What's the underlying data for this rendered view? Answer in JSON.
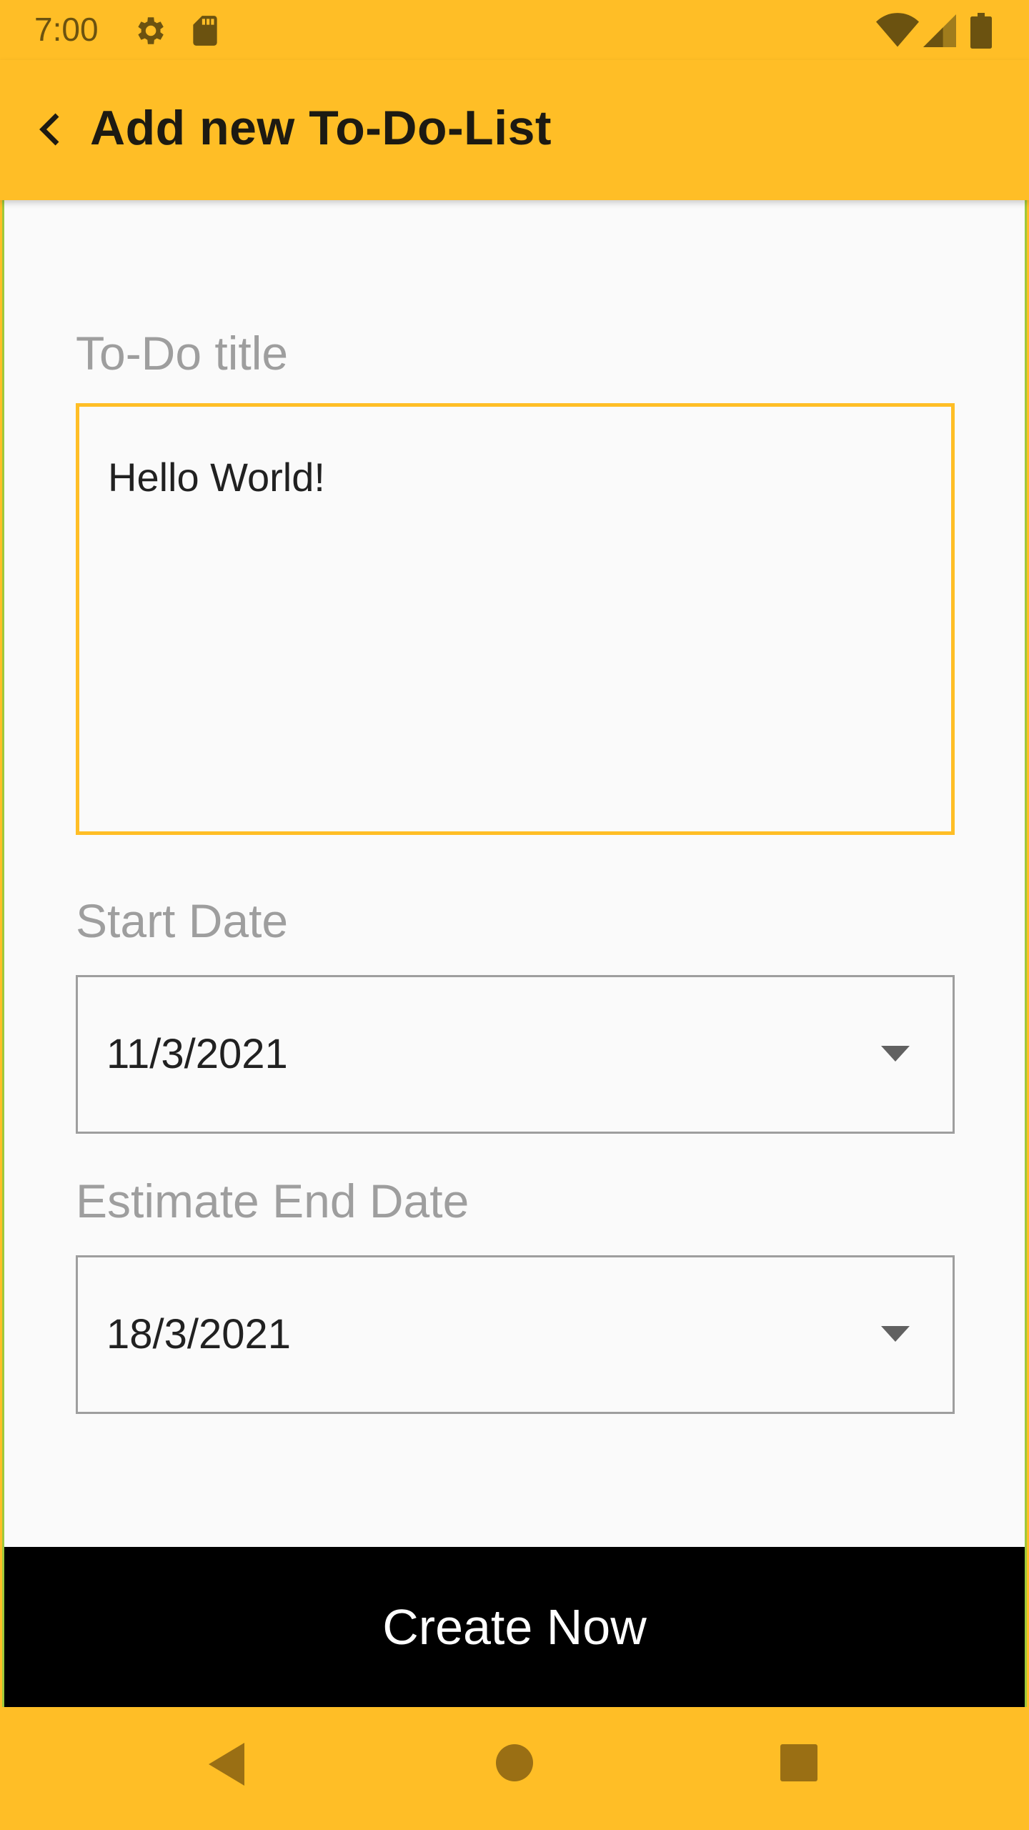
{
  "status_bar": {
    "time": "7:00",
    "icons": [
      "gear-icon",
      "sd-card-icon",
      "wifi-icon",
      "signal-icon",
      "battery-icon"
    ]
  },
  "app_bar": {
    "title": "Add new To-Do-List",
    "back_icon": "chevron-left-icon"
  },
  "form": {
    "title_label": "To-Do title",
    "title_value": "Hello World!",
    "start_label": "Start Date",
    "start_value": "11/3/2021",
    "end_label": "Estimate End Date",
    "end_value": "18/3/2021"
  },
  "actions": {
    "create_label": "Create Now"
  },
  "nav_bar": {
    "icons": [
      "back-triangle-icon",
      "home-circle-icon",
      "recents-square-icon"
    ]
  },
  "colors": {
    "accent": "#FFBE26",
    "button": "#000000",
    "label_gray": "#9E9E9E",
    "background": "#FAFAFA"
  }
}
